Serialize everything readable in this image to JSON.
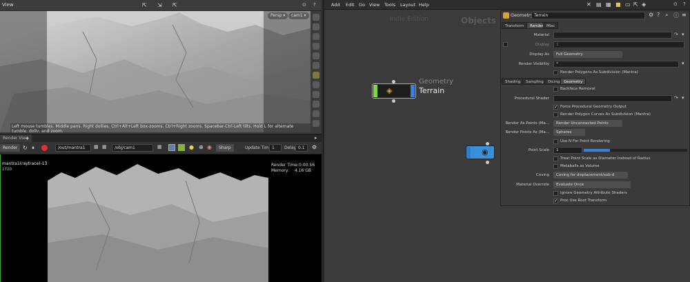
{
  "viewport": {
    "title": "View",
    "persp_label": "Persp",
    "camera_label": "cam1",
    "hint": "Left mouse tumbles. Middle pans. Right dollies. Ctrl+Alt+Left box-zooms. Ctrl+Right zooms. Spacebar-Ctrl-Left tilts. Hold L for alternate tumble, dolly, and zoom."
  },
  "render_view": {
    "tab_label": "Render View",
    "render_button": "Render",
    "rop_path": "/out/mantra1",
    "camera_path": "/obj/cam1",
    "sharp_label": "Sharp",
    "update_time_label": "Update Time",
    "update_time_value": "1",
    "delay_label": "Delay",
    "delay_value": "0.1",
    "render_label": "mantra1(raytrace)-13:15:46",
    "render_sub": "1720",
    "render_time_label": "Render Time:",
    "render_time_value": "0:00:56",
    "memory_label": "Memory:",
    "memory_value": "4.16 GB"
  },
  "network": {
    "menu": [
      "Add",
      "Edit",
      "Go",
      "View",
      "Tools",
      "Layout",
      "Help"
    ],
    "watermark": "Indie Edition",
    "context": "Objects",
    "node_type": "Geometry",
    "node_name": "Terrain"
  },
  "params": {
    "node_type": "Geometry",
    "node_name": "Terrain",
    "top_tabs": [
      "Transform",
      "Render",
      "Misc"
    ],
    "material_label": "Material",
    "display_label": "Display",
    "display_value": "1",
    "display_as_label": "Display As",
    "display_as_value": "Full Geometry",
    "render_visibility_label": "Render Visibility",
    "render_visibility_value": "*",
    "render_polygons_label": "Render Polygons As Subdivision (Mantra)",
    "sub_tabs": [
      "Shading",
      "Sampling",
      "Dicing",
      "Geometry"
    ],
    "backface_label": "Backface Removal",
    "procedural_shader_label": "Procedural Shader",
    "force_procedural_label": "Force Procedural Geometry Output",
    "render_curves_label": "Render Polygon Curves As Subdivision (Mantra)",
    "render_as_points_label": "Render As Points (Ma...",
    "render_as_points_value": "Render Unconnected Points",
    "render_points_as_label": "Render Points As (Ma...",
    "render_points_as_value": "Spheres",
    "use_n_label": "Use N For Point Rendering",
    "point_scale_label": "Point Scale",
    "point_scale_value": "1",
    "point_scale_fraction": 0.25,
    "treat_point_scale_label": "Treat Point Scale as Diameter Instead of Radius",
    "metaballs_label": "Metaballs as Volume",
    "coving_label": "Coving",
    "coving_value": "Coving for displacement/sub-d",
    "material_override_label": "Material Override",
    "material_override_value": "Evaluate Once",
    "ignore_geo_label": "Ignore Geometry Attribute Shaders",
    "proc_use_root_label": "Proc Use Root Transform"
  },
  "colors": {
    "node_green": "#7fd93a",
    "node_blue": "#3a7fd9",
    "render_green": "#3aa63a"
  }
}
